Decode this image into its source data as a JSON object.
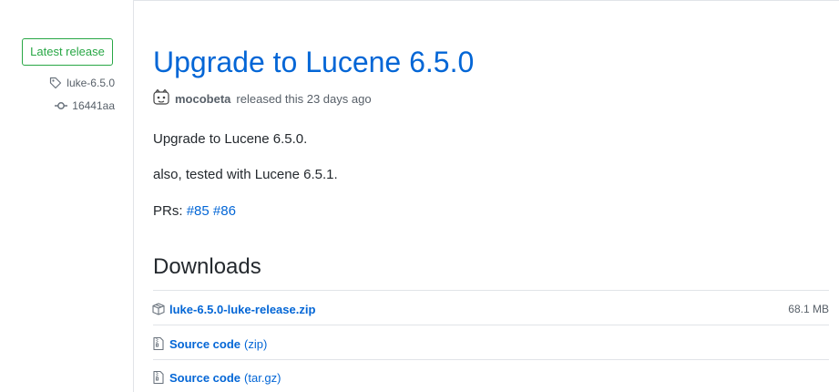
{
  "sidebar": {
    "badge": "Latest release",
    "tag": "luke-6.5.0",
    "commit": "16441aa"
  },
  "release": {
    "title": "Upgrade to Lucene 6.5.0",
    "author": "mocobeta",
    "released_text": "released this 23 days ago",
    "body": {
      "line1": "Upgrade to Lucene 6.5.0.",
      "line2": "also, tested with Lucene 6.5.1.",
      "prs_label": "PRs:",
      "pr1": "#85",
      "pr2": "#86"
    }
  },
  "downloads": {
    "heading": "Downloads",
    "items": [
      {
        "name": "luke-6.5.0-luke-release.zip",
        "ext": "",
        "size": "68.1 MB",
        "icon": "package-icon"
      },
      {
        "name": "Source code",
        "ext": "(zip)",
        "size": "",
        "icon": "file-zip-icon"
      },
      {
        "name": "Source code",
        "ext": "(tar.gz)",
        "size": "",
        "icon": "file-zip-icon"
      }
    ]
  }
}
